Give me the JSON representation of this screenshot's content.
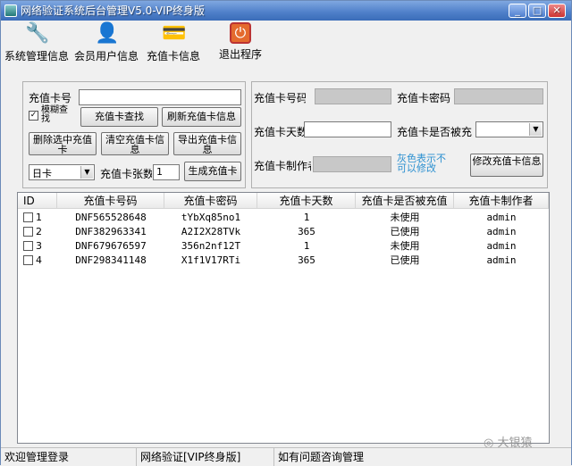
{
  "window": {
    "title": "网络验证系统后台管理V5.0-VIP终身版"
  },
  "controls": {
    "minimize": "_",
    "maximize": "□",
    "close": "✕"
  },
  "toolbar": {
    "items": [
      {
        "label": "系统管理信息",
        "icon": "wrench-icon"
      },
      {
        "label": "会员用户信息",
        "icon": "user-icon"
      },
      {
        "label": "充值卡信息",
        "icon": "card-icon"
      },
      {
        "label": "退出程序",
        "icon": "exit-icon"
      }
    ]
  },
  "left_panel": {
    "card_no_label": "充值卡号",
    "card_no_value": "",
    "fuzzy_label": "模糊查找",
    "fuzzy_checked": true,
    "search_button": "充值卡查找",
    "refresh_button": "刷新充值卡信息",
    "delete_button": "删除选中充值卡",
    "clear_button": "清空充值卡信息",
    "export_button": "导出充值卡信息",
    "card_type": "日卡",
    "count_label": "充值卡张数",
    "count_value": "1",
    "generate_button": "生成充值卡"
  },
  "right_panel": {
    "card_no_label": "充值卡号码",
    "card_no_value": "",
    "password_label": "充值卡密码",
    "password_value": "",
    "days_label": "充值卡天数",
    "days_value": "",
    "recharged_label": "充值卡是否被充",
    "recharged_value": "",
    "creator_label": "充值卡制作者",
    "creator_value": "",
    "hint": "灰色表示不可以修改",
    "modify_button": "修改充值卡信息"
  },
  "table": {
    "columns": [
      "ID",
      "充值卡号码",
      "充值卡密码",
      "充值卡天数",
      "充值卡是否被充值",
      "充值卡制作者"
    ],
    "rows": [
      {
        "id": "1",
        "card_no": "DNF565528648",
        "password": "tYbXq85no1",
        "days": "1",
        "status": "未使用",
        "creator": "admin"
      },
      {
        "id": "2",
        "card_no": "DNF382963341",
        "password": "A2I2X28TVk",
        "days": "365",
        "status": "已使用",
        "creator": "admin"
      },
      {
        "id": "3",
        "card_no": "DNF679676597",
        "password": "356n2nf12T",
        "days": "1",
        "status": "未使用",
        "creator": "admin"
      },
      {
        "id": "4",
        "card_no": "DNF298341148",
        "password": "X1f1V17RTi",
        "days": "365",
        "status": "已使用",
        "creator": "admin"
      }
    ]
  },
  "statusbar": {
    "welcome": "欢迎管理登录",
    "edition": "网络验证[VIP终身版]",
    "contact": "如有问题咨询管理"
  },
  "watermark": "大银猿",
  "colors": {
    "title_bar": "#4e7fc9",
    "hint_text": "#2a8fd0",
    "locked_field": "#c8c8c8"
  }
}
